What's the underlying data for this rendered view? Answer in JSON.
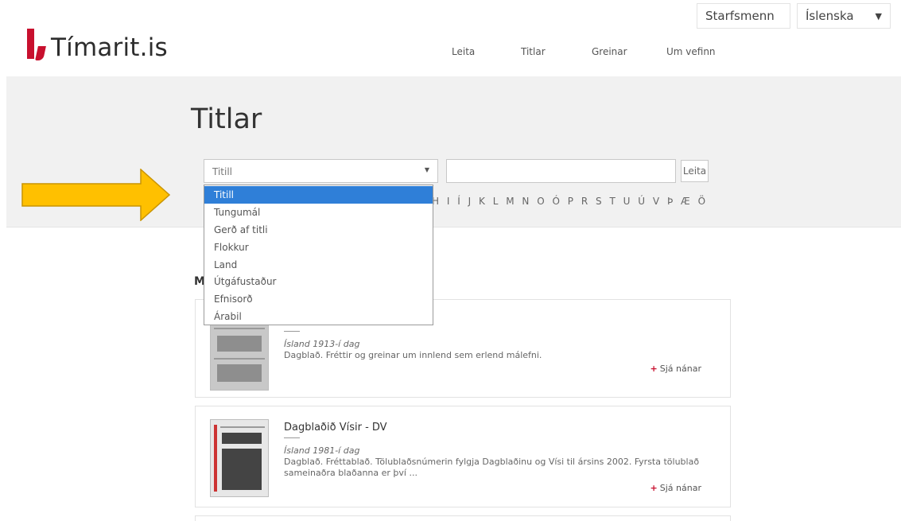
{
  "brand": {
    "logo_text": "Tímarit.is",
    "accent": "#c8102e"
  },
  "header": {
    "staff_label": "Starfsmenn",
    "language_label": "Íslenska",
    "nav": [
      "Leita",
      "Titlar",
      "Greinar",
      "Um vefinn"
    ]
  },
  "page": {
    "title": "Titlar"
  },
  "search": {
    "select_value": "Titill",
    "button_label": "Leita",
    "options": [
      "Titill",
      "Tungumál",
      "Gerð af titli",
      "Flokkur",
      "Land",
      "Útgáfustaður",
      "Efnisorð",
      "Árabil"
    ],
    "selected_option": "Titill",
    "highlight_color": "#2f7fd8"
  },
  "alphabet": [
    "H",
    "I",
    "Í",
    "J",
    "K",
    "L",
    "M",
    "N",
    "O",
    "Ó",
    "P",
    "R",
    "S",
    "T",
    "U",
    "Ú",
    "V",
    "Þ",
    "Æ",
    "Ö"
  ],
  "results": {
    "heading": "M",
    "cards": [
      {
        "meta": "Ísland 1913-í dag",
        "description": "Dagblað. Fréttir og greinar um innlend sem erlend málefni.",
        "more_label": "Sjá nánar"
      },
      {
        "title": "Dagblaðið Vísir - DV",
        "meta": "Ísland 1981-í dag",
        "description": "Dagblað. Fréttablað. Tölublaðsnúmerin fylgja Dagblaðinu og Vísi til ársins 2002. Fyrsta tölublað sameinaðra blaðanna er því ...",
        "more_label": "Sjá nánar"
      }
    ]
  },
  "annotation": {
    "arrow_color": "#ffc000",
    "arrow_border": "#c99400"
  }
}
